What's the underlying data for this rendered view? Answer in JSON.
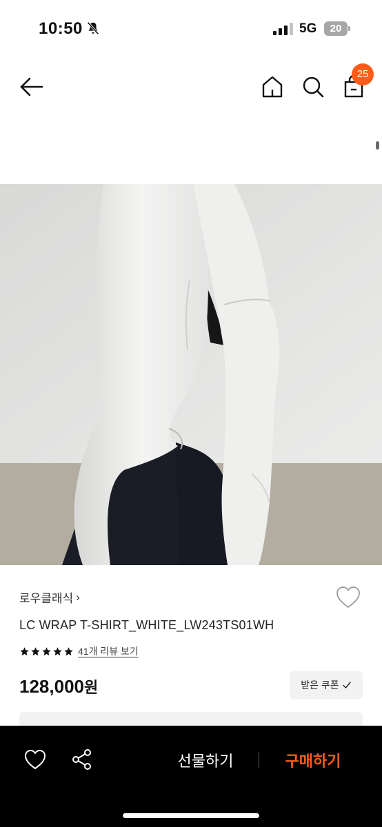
{
  "status_bar": {
    "time": "10:50",
    "network": "5G",
    "battery": "20"
  },
  "header": {
    "cart_count": "25",
    "icons": [
      "back-arrow-icon",
      "home-icon",
      "search-icon",
      "shopping-bag-icon"
    ]
  },
  "product": {
    "brand": "로우클래식",
    "brand_chevron": "›",
    "name": "LC WRAP T-SHIRT_WHITE_LW243TS01WH",
    "rating_stars": 5,
    "review_link": "41개 리뷰 보기",
    "price": "128,000",
    "price_unit": "원",
    "coupon_label": "받은 쿠폰"
  },
  "bottom_bar": {
    "gift_label": "선물하기",
    "buy_label": "구매하기"
  },
  "colors": {
    "accent": "#ff5b19",
    "bar_bg": "#000000",
    "battery": "#a7a7a7"
  }
}
